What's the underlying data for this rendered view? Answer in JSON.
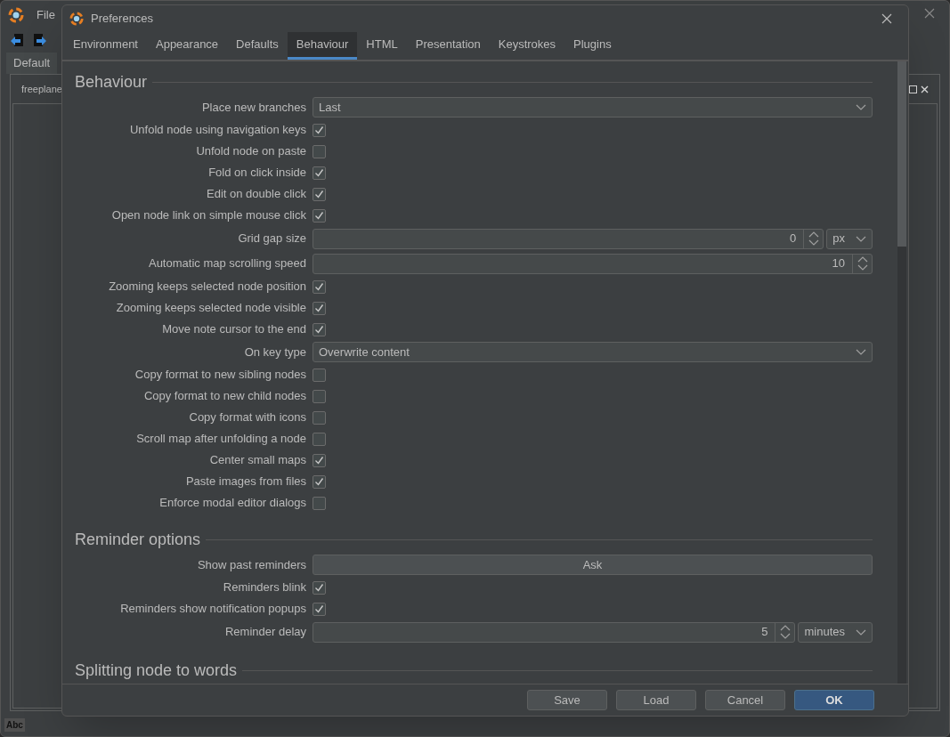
{
  "app": {
    "menu": [
      "File"
    ],
    "doc_tab": "Default",
    "map_tab": "freeplane",
    "status": "Abc"
  },
  "dialog": {
    "title": "Preferences",
    "tabs": [
      {
        "label": "Environment",
        "selected": false
      },
      {
        "label": "Appearance",
        "selected": false
      },
      {
        "label": "Defaults",
        "selected": false
      },
      {
        "label": "Behaviour",
        "selected": true
      },
      {
        "label": "HTML",
        "selected": false
      },
      {
        "label": "Presentation",
        "selected": false
      },
      {
        "label": "Keystrokes",
        "selected": false
      },
      {
        "label": "Plugins",
        "selected": false
      }
    ],
    "sections": [
      {
        "title": "Behaviour",
        "rows": [
          {
            "kind": "combo",
            "label": "Place new branches",
            "value": "Last"
          },
          {
            "kind": "check",
            "label": "Unfold node using navigation keys",
            "checked": true
          },
          {
            "kind": "check",
            "label": "Unfold node on paste",
            "checked": false
          },
          {
            "kind": "check",
            "label": "Fold on click inside",
            "checked": true
          },
          {
            "kind": "check",
            "label": "Edit on double click",
            "checked": true
          },
          {
            "kind": "check",
            "label": "Open node link on simple mouse click",
            "checked": true
          },
          {
            "kind": "spinner",
            "label": "Grid gap size",
            "value": "0",
            "unit": "px"
          },
          {
            "kind": "spinner",
            "label": "Automatic map scrolling speed",
            "value": "10"
          },
          {
            "kind": "check",
            "label": "Zooming keeps selected node position",
            "checked": true
          },
          {
            "kind": "check",
            "label": "Zooming keeps selected node visible",
            "checked": true
          },
          {
            "kind": "check",
            "label": "Move note cursor to the end",
            "checked": true
          },
          {
            "kind": "combo",
            "label": "On key type",
            "value": "Overwrite content"
          },
          {
            "kind": "check",
            "label": "Copy format to new sibling nodes",
            "checked": false
          },
          {
            "kind": "check",
            "label": "Copy format to new child nodes",
            "checked": false
          },
          {
            "kind": "check",
            "label": "Copy format with icons",
            "checked": false
          },
          {
            "kind": "check",
            "label": "Scroll map after unfolding a node",
            "checked": false
          },
          {
            "kind": "check",
            "label": "Center small maps",
            "checked": true
          },
          {
            "kind": "check",
            "label": "Paste images from files",
            "checked": true
          },
          {
            "kind": "check",
            "label": "Enforce modal editor dialogs",
            "checked": false
          }
        ]
      },
      {
        "title": "Reminder options",
        "rows": [
          {
            "kind": "button",
            "label": "Show past reminders",
            "value": "Ask"
          },
          {
            "kind": "check",
            "label": "Reminders blink",
            "checked": true
          },
          {
            "kind": "check",
            "label": "Reminders show notification popups",
            "checked": true
          },
          {
            "kind": "spinner",
            "label": "Reminder delay",
            "value": "5",
            "unit": "minutes"
          }
        ]
      },
      {
        "title": "Splitting node to words"
      }
    ],
    "buttons": [
      {
        "label": "Save",
        "primary": false
      },
      {
        "label": "Load",
        "primary": false
      },
      {
        "label": "Cancel",
        "primary": false
      },
      {
        "label": "OK",
        "primary": true
      }
    ]
  }
}
